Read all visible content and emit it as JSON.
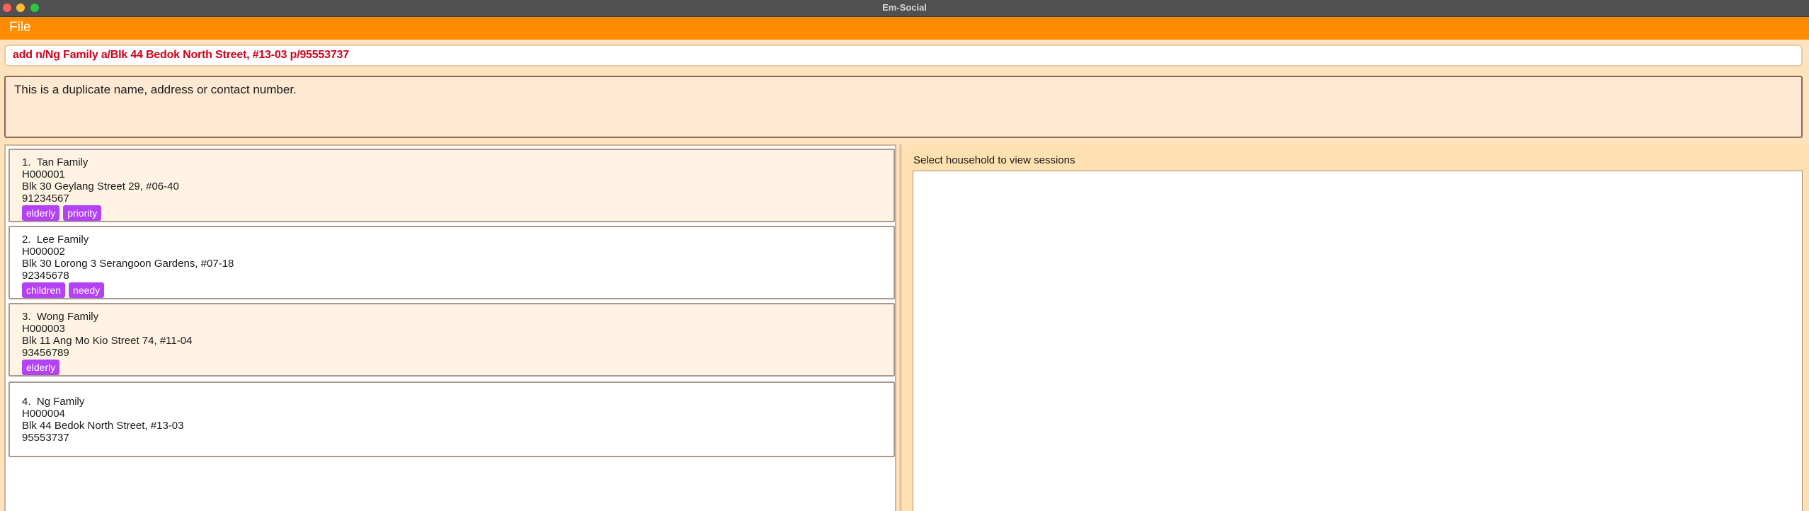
{
  "window": {
    "title": "Em-Social"
  },
  "menu": {
    "file": "File"
  },
  "command": {
    "value": "add n/Ng Family a/Blk 44 Bedok North Street, #13-03 p/95553737"
  },
  "result": {
    "message": "This is a duplicate name, address or contact number."
  },
  "households": [
    {
      "index": "1.",
      "name": "Tan Family",
      "id": "H000001",
      "address": "Blk 30 Geylang Street 29, #06-40",
      "phone": "91234567",
      "tags": [
        "elderly",
        "priority"
      ]
    },
    {
      "index": "2.",
      "name": "Lee Family",
      "id": "H000002",
      "address": "Blk 30 Lorong 3 Serangoon Gardens, #07-18",
      "phone": "92345678",
      "tags": [
        "children",
        "needy"
      ]
    },
    {
      "index": "3.",
      "name": "Wong Family",
      "id": "H000003",
      "address": "Blk 11 Ang Mo Kio Street 74, #11-04",
      "phone": "93456789",
      "tags": [
        "elderly"
      ]
    },
    {
      "index": "4.",
      "name": "Ng Family",
      "id": "H000004",
      "address": "Blk 44 Bedok North Street, #13-03",
      "phone": "95553737",
      "tags": []
    }
  ],
  "sessions": {
    "placeholder": "Select household to view sessions"
  },
  "colors": {
    "accent": "#ff8c00",
    "tag": "#b342f5",
    "command_text": "#d0021b",
    "background": "#ffe3bf"
  }
}
